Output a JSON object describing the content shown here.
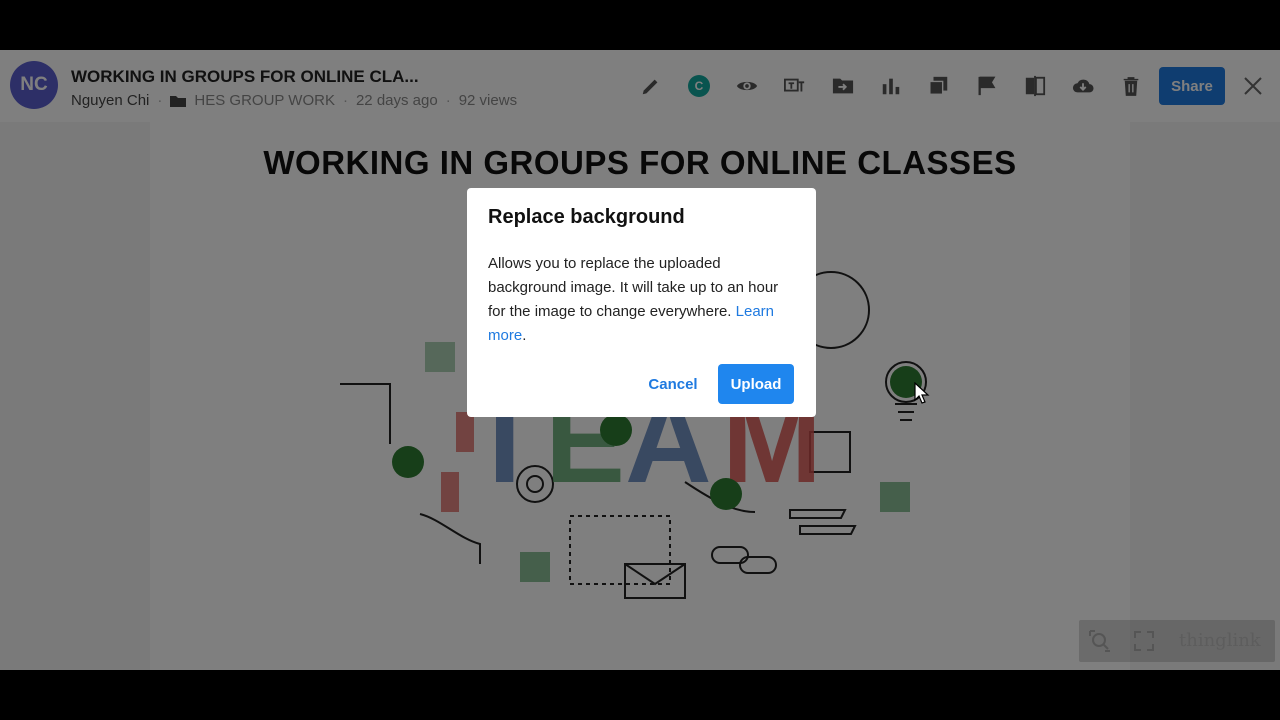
{
  "header": {
    "avatar_initials": "NC",
    "title": "WORKING IN GROUPS FOR ONLINE CLA...",
    "author": "Nguyen Chi",
    "folder": "HES GROUP WORK",
    "age": "22 days ago",
    "views": "92 views",
    "separator": "·",
    "collab_badge": "C",
    "share_label": "Share",
    "toolbar_icons": [
      "pencil-icon",
      "collaborator-icon",
      "eye-icon",
      "translate-icon",
      "move-folder-icon",
      "stats-icon",
      "duplicate-icon",
      "flag-icon",
      "replace-background-icon",
      "download-icon",
      "trash-icon"
    ]
  },
  "canvas": {
    "title": "WORKING IN GROUPS FOR ONLINE CLASSES",
    "word": "TEAM",
    "logo": "thinglink"
  },
  "modal": {
    "title": "Replace background",
    "body": "Allows you to replace the uploaded background image. It will take up to an hour for the image to change everywhere.",
    "link_text": "Learn more",
    "link_suffix": ".",
    "cancel_label": "Cancel",
    "upload_label": "Upload"
  },
  "colors": {
    "accent": "#1f7ae0",
    "avatar": "#5a5fcf",
    "badge": "#13a89e",
    "hotspot": "#2e7d32"
  }
}
